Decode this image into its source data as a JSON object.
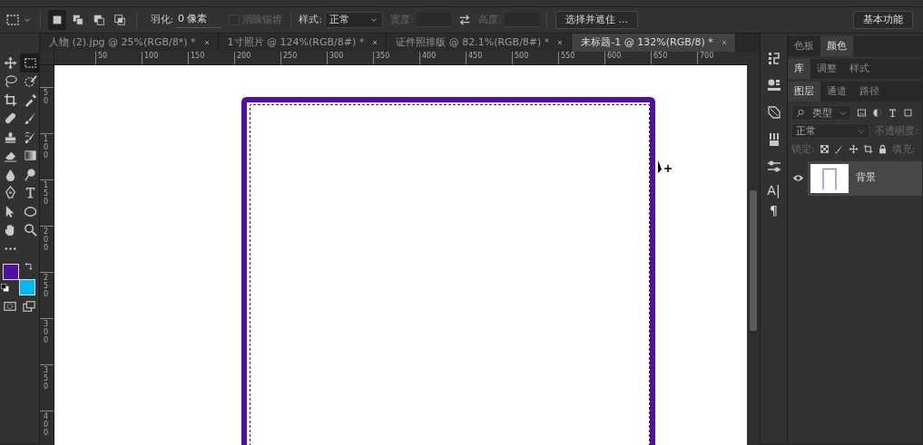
{
  "options_bar": {
    "modes": [
      {
        "kind": "new",
        "selected": true
      },
      {
        "kind": "add",
        "selected": false
      },
      {
        "kind": "subtract",
        "selected": false
      },
      {
        "kind": "intersect",
        "selected": false
      }
    ],
    "feather_label": "羽化:",
    "feather_value": "0 像素",
    "anti_alias": {
      "label": "消除锯齿",
      "checked": false,
      "disabled": true
    },
    "style_label": "样式:",
    "style_value": "正常",
    "width_label": "宽度:",
    "height_label": "高度:",
    "select_mask_button": "选择并遮住 ...",
    "workspace_button": "基本功能"
  },
  "tabs": [
    {
      "label": "人物 (2).jpg @ 25%(RGB/8*) *",
      "selected": false
    },
    {
      "label": "1寸照片 @ 124%(RGB/8#) *",
      "selected": false
    },
    {
      "label": "证件照排版 @ 82.1%(RGB/8#) *",
      "selected": false
    },
    {
      "label": "未标题-1 @ 132%(RGB/8) *",
      "selected": true
    }
  ],
  "tools": [
    {
      "kind": "move",
      "selected": false
    },
    {
      "kind": "marquee",
      "selected": true
    },
    {
      "kind": "lasso",
      "selected": false
    },
    {
      "kind": "quick-select",
      "selected": false
    },
    {
      "kind": "crop",
      "selected": false
    },
    {
      "kind": "eyedropper",
      "selected": false
    },
    {
      "kind": "healing",
      "selected": false
    },
    {
      "kind": "brush",
      "selected": false
    },
    {
      "kind": "stamp",
      "selected": false
    },
    {
      "kind": "history-brush",
      "selected": false
    },
    {
      "kind": "eraser",
      "selected": false
    },
    {
      "kind": "gradient",
      "selected": false
    },
    {
      "kind": "blur",
      "selected": false
    },
    {
      "kind": "dodge",
      "selected": false
    },
    {
      "kind": "pen",
      "selected": false
    },
    {
      "kind": "type",
      "selected": false
    },
    {
      "kind": "path-select",
      "selected": false
    },
    {
      "kind": "ellipse",
      "selected": false
    },
    {
      "kind": "hand",
      "selected": false
    },
    {
      "kind": "zoom",
      "selected": false
    },
    {
      "kind": "more",
      "selected": false
    }
  ],
  "colors": [
    {
      "kind": "foreground",
      "color": "#5210a0"
    },
    {
      "kind": "background",
      "color": "#00b8f0"
    }
  ],
  "rulers": {
    "horizontal": [
      "50",
      "100",
      "150",
      "200",
      "250",
      "300",
      "350",
      "400",
      "450",
      "500",
      "550",
      "600",
      "650",
      "700"
    ],
    "vertical": [
      "50",
      "100",
      "150",
      "200",
      "250",
      "300",
      "350",
      "400"
    ]
  },
  "panel_icons": [
    {
      "kind": "history"
    },
    {
      "kind": "adjust"
    },
    {
      "kind": "transform"
    },
    {
      "kind": "brushes"
    },
    {
      "kind": "sliders"
    },
    {
      "kind": "character",
      "label": "A|"
    },
    {
      "kind": "paragraph",
      "label": "¶"
    }
  ],
  "panel_tabs": [
    [
      {
        "label": "色板",
        "selected": false
      },
      {
        "label": "颜色",
        "selected": true
      }
    ],
    [
      {
        "label": "库",
        "selected": true
      },
      {
        "label": "调整",
        "selected": false
      },
      {
        "label": "样式",
        "selected": false
      }
    ],
    [
      {
        "label": "图层",
        "selected": true
      },
      {
        "label": "通道",
        "selected": false
      },
      {
        "label": "路径",
        "selected": false
      }
    ]
  ],
  "layers": {
    "filter": "类型",
    "blend_mode": "正常",
    "opacity_label": "不透明度:",
    "lock_label": "锁定:",
    "fill_label": "填充:",
    "items": [
      {
        "name": "背景",
        "visible": true,
        "selected": true
      }
    ]
  }
}
